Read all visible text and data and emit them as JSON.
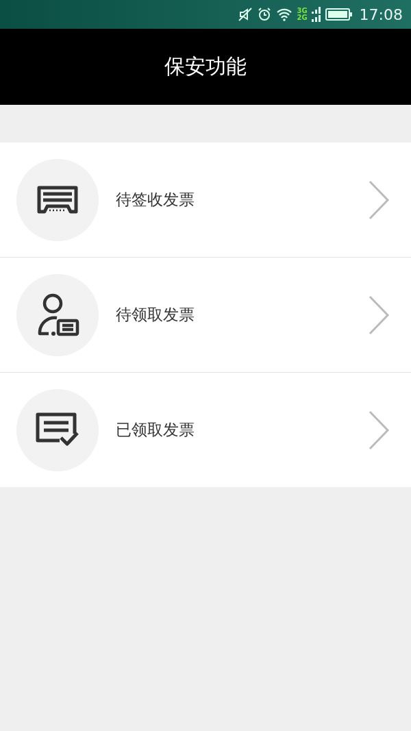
{
  "status_bar": {
    "network_labels": [
      "3G",
      "2G"
    ],
    "time": "17:08"
  },
  "header": {
    "title": "保安功能"
  },
  "menu": [
    {
      "label": "待签收发票",
      "kind": "printer"
    },
    {
      "label": "待领取发票",
      "kind": "person"
    },
    {
      "label": "已领取发票",
      "kind": "checked"
    }
  ]
}
